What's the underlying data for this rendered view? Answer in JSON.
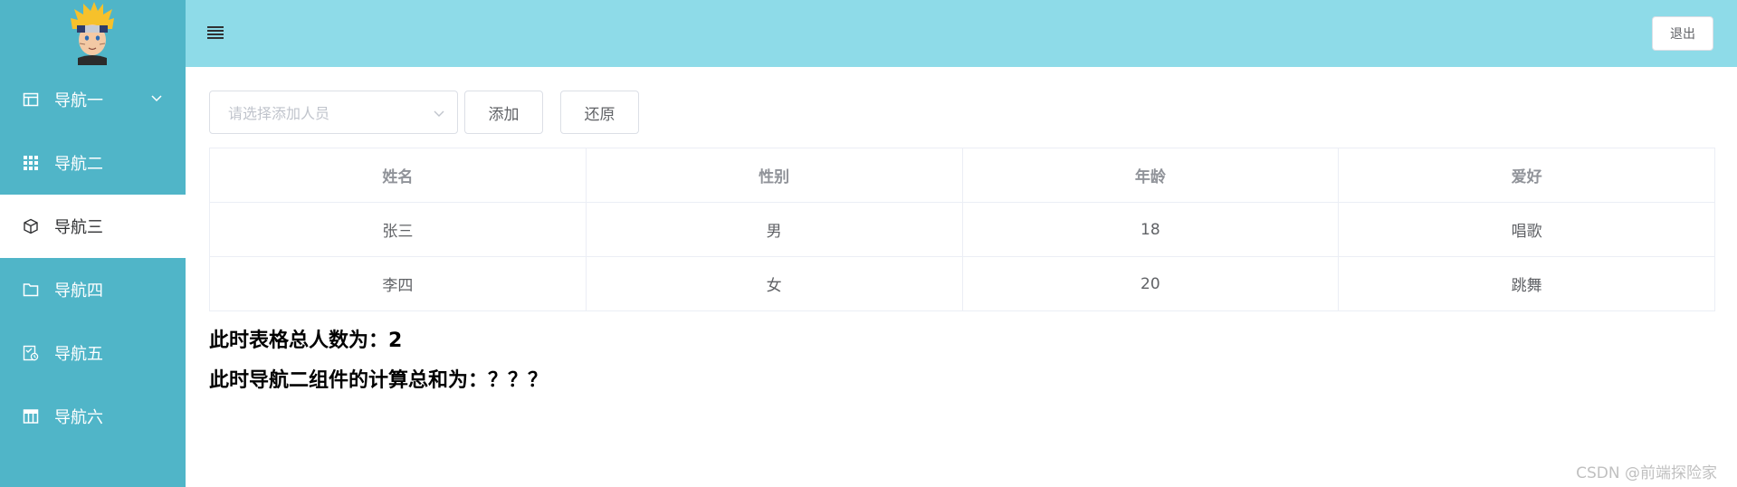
{
  "sidebar": {
    "items": [
      {
        "label": "导航一",
        "icon": "table-icon",
        "expandable": true
      },
      {
        "label": "导航二",
        "icon": "grid-icon"
      },
      {
        "label": "导航三",
        "icon": "box-icon",
        "active": true
      },
      {
        "label": "导航四",
        "icon": "folder-icon"
      },
      {
        "label": "导航五",
        "icon": "clipboard-clock-icon"
      },
      {
        "label": "导航六",
        "icon": "table-layout-icon"
      }
    ],
    "colors": {
      "background": "#50b5c8",
      "active_background": "#ffffff"
    }
  },
  "header": {
    "logout_label": "退出",
    "background": "#8edbe8"
  },
  "toolbar": {
    "select_placeholder": "请选择添加人员",
    "add_label": "添加",
    "reset_label": "还原"
  },
  "table": {
    "columns": [
      "姓名",
      "性别",
      "年龄",
      "爱好"
    ],
    "rows": [
      [
        "张三",
        "男",
        "18",
        "唱歌"
      ],
      [
        "李四",
        "女",
        "20",
        "跳舞"
      ]
    ]
  },
  "summary": {
    "total_people": "此时表格总人数为：2",
    "nav2_sum": "此时导航二组件的计算总和为：？？？"
  },
  "watermark": "CSDN @前端探险家"
}
